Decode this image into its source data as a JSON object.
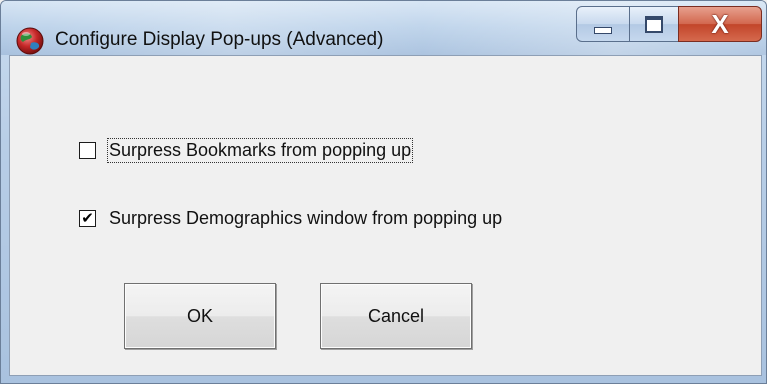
{
  "window": {
    "title": "Configure Display Pop-ups (Advanced)",
    "app_icon": "globe-icon",
    "minimize_icon": "minimize-icon",
    "maximize_icon": "maximize-icon",
    "close_glyph": "X"
  },
  "options": [
    {
      "label": "Surpress Bookmarks from popping up",
      "checked": false,
      "check_glyph": ""
    },
    {
      "label": "Surpress Demographics window from popping up",
      "checked": true,
      "check_glyph": "✔"
    }
  ],
  "buttons": {
    "ok_label": "OK",
    "cancel_label": "Cancel"
  },
  "colors": {
    "titlebar": "#bcd2ea",
    "close_button": "#c2452a",
    "dialog_background": "#f0f0f0"
  }
}
